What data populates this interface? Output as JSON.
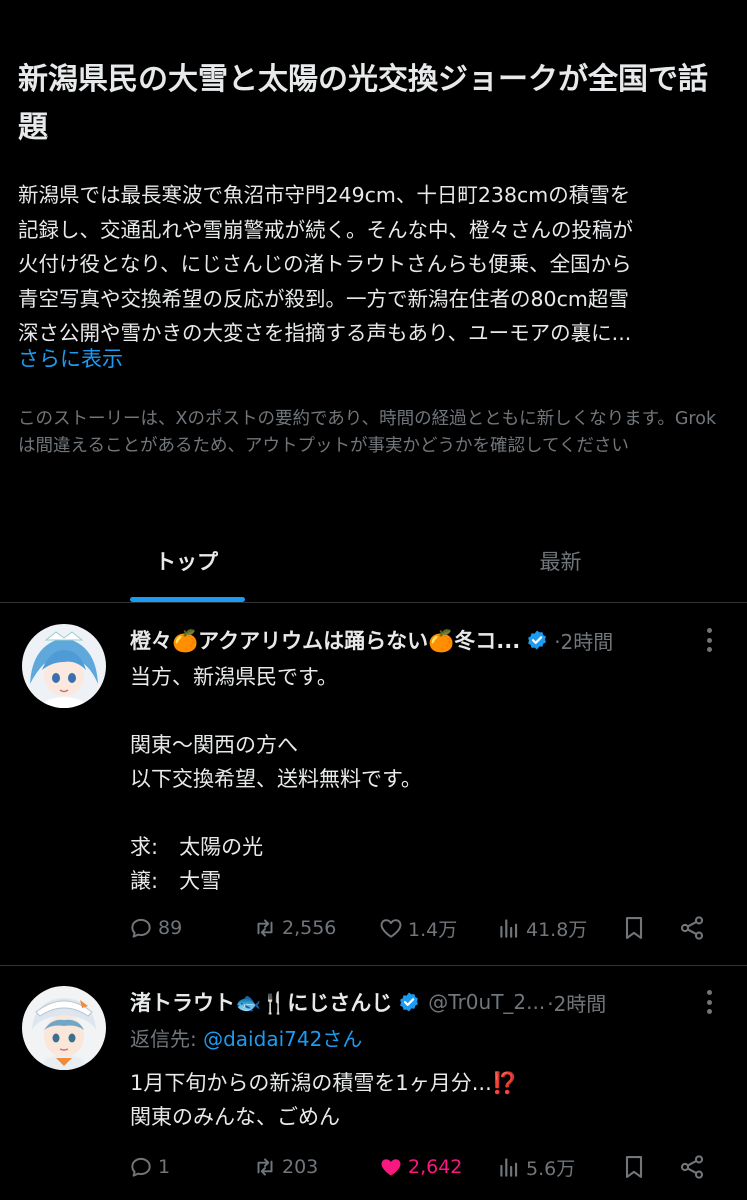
{
  "headline": "新潟県民の大雪と太陽の光交換ジョークが全国で話題",
  "summary_lines": [
    "新潟県では最長寒波で魚沼市守門249cm、十日町238cmの積雪を",
    "記録し、交通乱れや雪崩警戒が続く。そんな中、橙々さんの投稿が",
    "火付け役となり、にじさんじの渚トラウトさんらも便乗、全国から",
    "青空写真や交換希望の反応が殺到。一方で新潟在住者の80cm超雪",
    "深さ公開や雪かきの大変さを指摘する声もあり、ユーモアの裏に..."
  ],
  "show_more": "さらに表示",
  "disclaimer": "このストーリーは、Xのポストの要約であり、時間の経過とともに新しくなります。Grokは間違えることがあるため、アウトプットが事実かどうかを確認してください",
  "tabs": {
    "top": "トップ",
    "latest": "最新"
  },
  "posts": [
    {
      "author": "橙々🍊アクアリウムは踊らない🍊冬コ...",
      "time": "·2時間",
      "body_lines": [
        "当方、新潟県民です。",
        "",
        "関東〜関西の方へ",
        "以下交換希望、送料無料です。",
        "",
        "求:　太陽の光",
        "譲:　大雪"
      ],
      "replies": "89",
      "reposts": "2,556",
      "likes": "1.4万",
      "views": "41.8万"
    },
    {
      "author": "渚トラウト🐟🍴にじさんじ",
      "handle": "@Tr0uT_2...",
      "time": "·2時間",
      "reply_prefix": "返信先:",
      "reply_mention": "@daidai742さん",
      "body_lines": [
        "1月下旬からの新潟の積雪を1ヶ月分...⁉️",
        "関東のみんな、ごめん"
      ],
      "replies": "1",
      "reposts": "203",
      "likes": "2,642",
      "views": "5.6万"
    }
  ],
  "colors": {
    "background": "#000000",
    "text": "#e7e9ea",
    "muted": "#71767b",
    "accent": "#1d9bf0",
    "like": "#f91880"
  },
  "icons": [
    "verified-badge-icon",
    "more-options-icon",
    "reply-icon",
    "repost-icon",
    "like-icon",
    "views-icon",
    "bookmark-icon",
    "share-icon"
  ]
}
